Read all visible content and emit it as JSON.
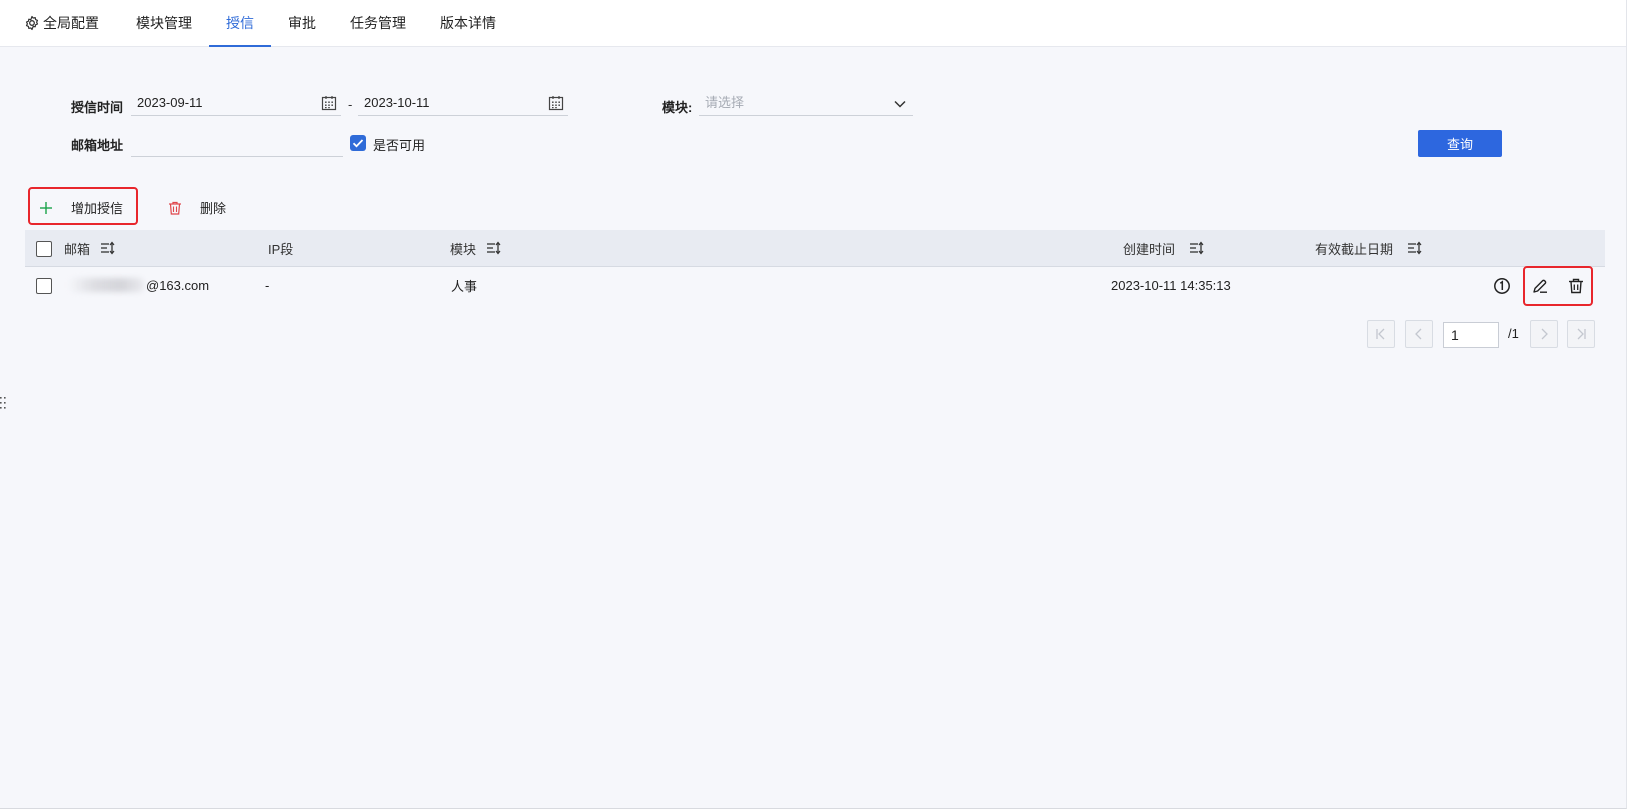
{
  "tabs": [
    {
      "label": "全局配置",
      "icon": "gear-icon",
      "active": false
    },
    {
      "label": "模块管理",
      "active": false
    },
    {
      "label": "授信",
      "active": true
    },
    {
      "label": "审批",
      "active": false
    },
    {
      "label": "任务管理",
      "active": false
    },
    {
      "label": "版本详情",
      "active": false
    }
  ],
  "filters": {
    "credit_time_label": "授信时间",
    "date_from": "2023-09-11",
    "date_sep": "-",
    "date_to": "2023-10-11",
    "module_label": "模块:",
    "module_placeholder": "请选择",
    "email_label": "邮箱地址",
    "email_value": "",
    "available_label": "是否可用",
    "available_checked": true,
    "query_button": "查询"
  },
  "toolbar": {
    "add_label": "增加授信",
    "delete_label": "删除"
  },
  "table": {
    "headers": {
      "email": "邮箱",
      "ip": "IP段",
      "module": "模块",
      "created": "创建时间",
      "expiry": "有效截止日期"
    },
    "rows": [
      {
        "email_visible": "@163.com",
        "ip": "-",
        "module": "人事",
        "created": "2023-10-11 14:35:13",
        "expiry": ""
      }
    ]
  },
  "pagination": {
    "current": "1",
    "total": "/1"
  },
  "colors": {
    "accent": "#2f6bd8",
    "button": "#2d67df",
    "highlight": "#e8262c",
    "add_icon": "#1aa34a",
    "delete_icon": "#e0464b"
  }
}
